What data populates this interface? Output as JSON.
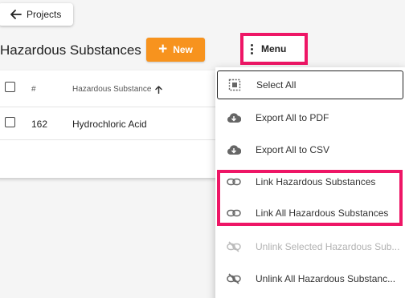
{
  "nav": {
    "back_label": "Projects"
  },
  "page": {
    "title": "Hazardous Substances"
  },
  "toolbar": {
    "new_label": "New",
    "menu_label": "Menu"
  },
  "colors": {
    "accent": "#f7931e",
    "highlight": "#ee1666"
  },
  "table": {
    "columns": [
      "#",
      "Hazardous Substance"
    ],
    "sort": {
      "column": "Hazardous Substance",
      "direction": "ascending"
    },
    "rows": [
      {
        "num": "162",
        "name": "Hydrochloric Acid"
      }
    ]
  },
  "menu": {
    "items": [
      {
        "label": "Select All",
        "icon": "select-all-icon",
        "enabled": true,
        "focused": true
      },
      {
        "label": "Export All to PDF",
        "icon": "cloud-download-icon",
        "enabled": true
      },
      {
        "label": "Export All to CSV",
        "icon": "cloud-download-icon",
        "enabled": true
      },
      {
        "label": "Link Hazardous Substances",
        "icon": "link-icon",
        "enabled": true,
        "highlighted": true
      },
      {
        "label": "Link All Hazardous Substances",
        "icon": "link-icon",
        "enabled": true,
        "highlighted": true
      },
      {
        "label": "Unlink Selected Hazardous Sub...",
        "icon": "link-off-icon",
        "enabled": false
      },
      {
        "label": "Unlink All Hazardous Substanc...",
        "icon": "link-off-icon",
        "enabled": true
      }
    ]
  }
}
